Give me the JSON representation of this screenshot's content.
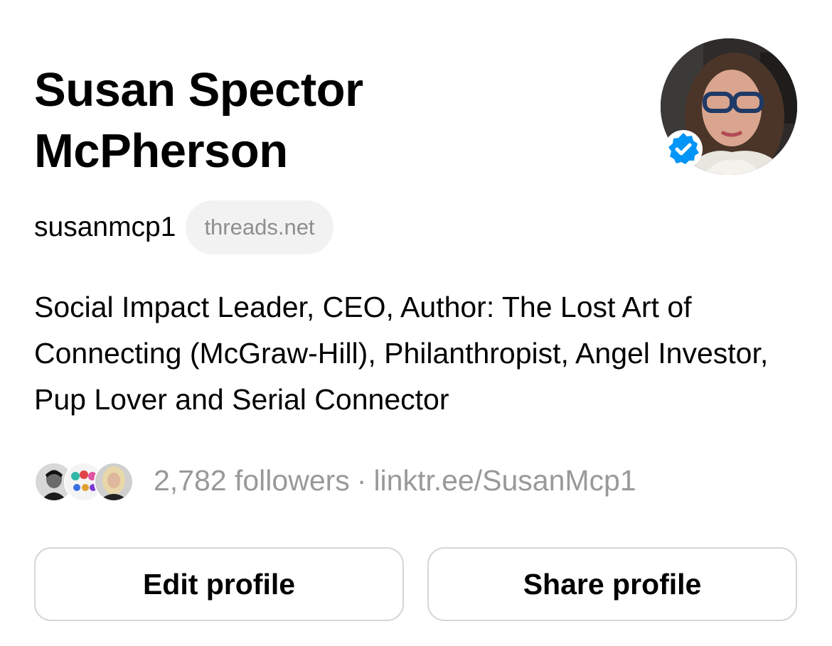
{
  "profile": {
    "display_name_line1": "Susan Spector",
    "display_name_line2": "McPherson",
    "username": "susanmcp1",
    "domain_badge": "threads.net",
    "verified": true,
    "bio": "Social Impact Leader, CEO, Author: The Lost Art of Connecting (McGraw-Hill), Philanthropist, Angel Investor, Pup Lover and Serial Connector",
    "followers_text": "2,782 followers",
    "separator": "·",
    "link_text": "linktr.ee/SusanMcp1"
  },
  "actions": {
    "edit_label": "Edit profile",
    "share_label": "Share profile"
  },
  "colors": {
    "text_primary": "#000000",
    "text_secondary": "#999999",
    "pill_background": "#f2f2f2",
    "button_border": "#d6d6d6",
    "verified_blue": "#0095f6"
  },
  "icons": {
    "verified": "verified-badge-icon"
  }
}
